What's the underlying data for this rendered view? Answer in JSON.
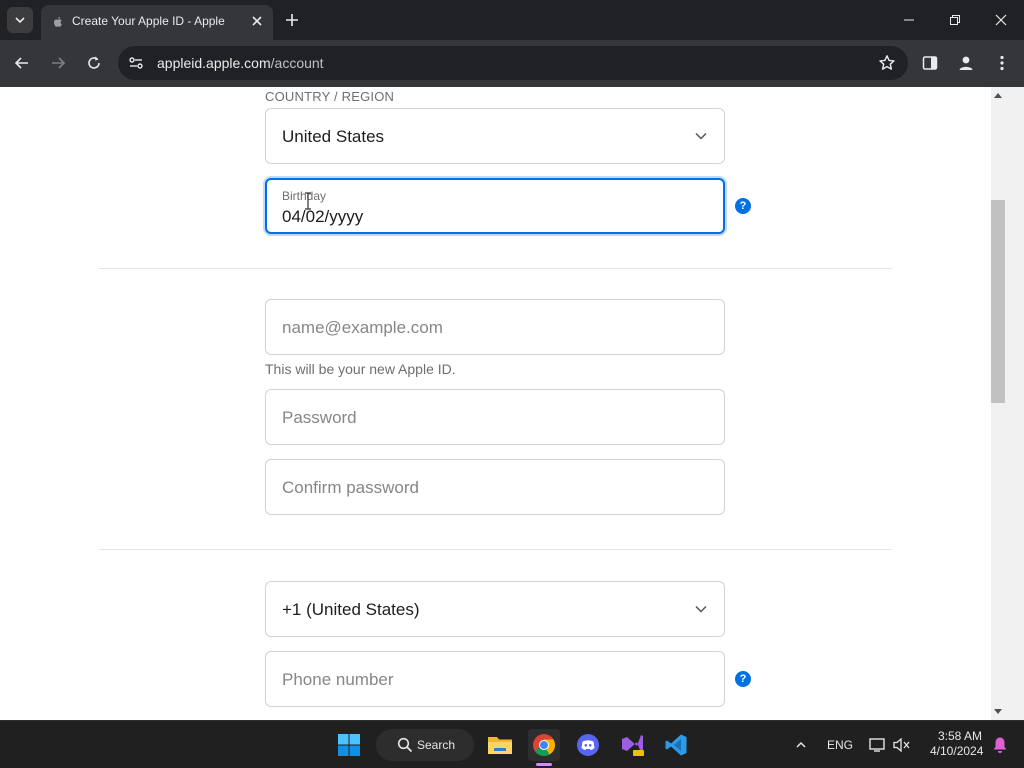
{
  "browser": {
    "tab_title": "Create Your Apple ID - Apple",
    "url_host": "appleid.apple.com",
    "url_path": "/account"
  },
  "form": {
    "country_label": "COUNTRY / REGION",
    "country_value": "United States",
    "birthday_label": "Birthday",
    "birthday_value": "04/02/yyyy",
    "help_glyph": "?",
    "email_placeholder": "name@example.com",
    "email_helper": "This will be your new Apple ID.",
    "password_placeholder": "Password",
    "confirm_password_placeholder": "Confirm password",
    "phone_country_value": "+1 (United States)",
    "phone_placeholder": "Phone number"
  },
  "taskbar": {
    "search_label": "Search",
    "language": "ENG",
    "time": "3:58 AM",
    "date": "4/10/2024"
  },
  "colors": {
    "accent": "#0071e3",
    "chrome_dark": "#202124",
    "toolbar": "#35363a"
  }
}
